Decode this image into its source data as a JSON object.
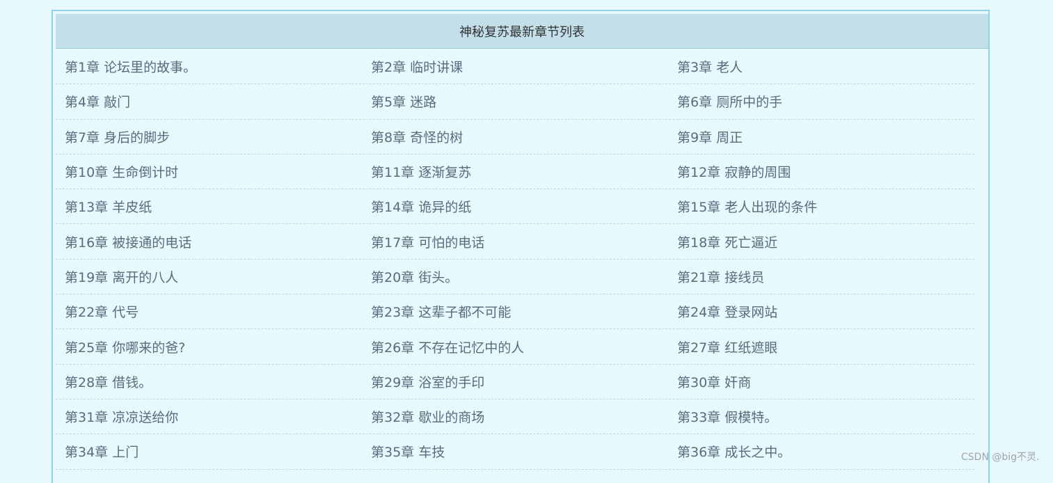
{
  "header": {
    "title": "神秘复苏最新章节列表"
  },
  "chapters": [
    [
      "第1章 论坛里的故事。",
      "第2章 临时讲课",
      "第3章 老人"
    ],
    [
      "第4章 敲门",
      "第5章 迷路",
      "第6章 厕所中的手"
    ],
    [
      "第7章 身后的脚步",
      "第8章 奇怪的树",
      "第9章 周正"
    ],
    [
      "第10章 生命倒计时",
      "第11章 逐渐复苏",
      "第12章 寂静的周围"
    ],
    [
      "第13章 羊皮纸",
      "第14章 诡异的纸",
      "第15章 老人出现的条件"
    ],
    [
      "第16章 被接通的电话",
      "第17章 可怕的电话",
      "第18章 死亡逼近"
    ],
    [
      "第19章 离开的八人",
      "第20章 街头。",
      "第21章 接线员"
    ],
    [
      "第22章 代号",
      "第23章 这辈子都不可能",
      "第24章 登录网站"
    ],
    [
      "第25章 你哪来的爸?",
      "第26章 不存在记忆中的人",
      "第27章 红纸遮眼"
    ],
    [
      "第28章 借钱。",
      "第29章 浴室的手印",
      "第30章 奸商"
    ],
    [
      "第31章 凉凉送给你",
      "第32章 歇业的商场",
      "第33章 假模特。"
    ],
    [
      "第34章 上门",
      "第35章 车技",
      "第36章 成长之中。"
    ]
  ],
  "watermark": "CSDN @big不灵."
}
